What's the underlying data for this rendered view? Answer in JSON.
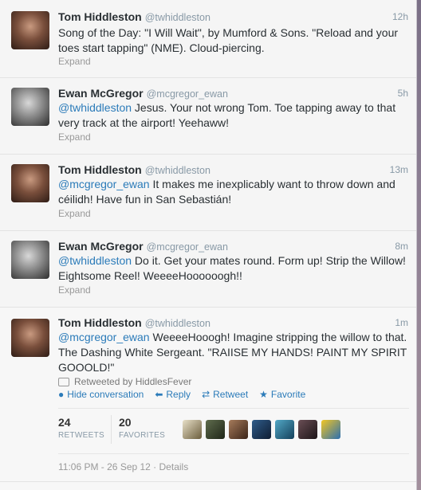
{
  "tweets": [
    {
      "name": "Tom Hiddleston",
      "handle": "@twhiddleston",
      "time": "12h",
      "mention": "",
      "text": "Song of the Day: \"I Will Wait\", by Mumford & Sons. \"Reload and your toes start tapping\" (NME). Cloud-piercing.",
      "expand": "Expand"
    },
    {
      "name": "Ewan McGregor",
      "handle": "@mcgregor_ewan",
      "time": "5h",
      "mention": "@twhiddleston",
      "text": " Jesus. Your not wrong Tom. Toe tapping away to that very track at the airport! Yeehaww!",
      "expand": "Expand"
    },
    {
      "name": "Tom Hiddleston",
      "handle": "@twhiddleston",
      "time": "13m",
      "mention": "@mcgregor_ewan",
      "text": " It makes me inexplicably want to throw down and céilidh! Have fun in San Sebastián!",
      "expand": "Expand"
    },
    {
      "name": "Ewan McGregor",
      "handle": "@mcgregor_ewan",
      "time": "8m",
      "mention": "@twhiddleston",
      "text": " Do it. Get your mates round. Form up! Strip the Willow! Eightsome Reel! WeeeeHoooooogh!!",
      "expand": "Expand"
    },
    {
      "name": "Tom Hiddleston",
      "handle": "@twhiddleston",
      "time": "1m",
      "mention": "@mcgregor_ewan",
      "text": " WeeeeHooogh! Imagine stripping the willow to that. The Dashing White Sergeant. \"RAIISE MY HANDS! PAINT MY SPIRIT GOOOLD!\""
    }
  ],
  "expanded": {
    "retweeted_by": "Retweeted by HiddlesFever",
    "actions": {
      "hide": "Hide conversation",
      "reply": "Reply",
      "retweet": "Retweet",
      "favorite": "Favorite"
    },
    "stats": {
      "retweets_count": "24",
      "retweets_label": "RETWEETS",
      "favorites_count": "20",
      "favorites_label": "FAVORITES"
    },
    "footer": "11:06 PM - 26 Sep 12 · Details"
  },
  "colors": {
    "link": "#2b7bb9",
    "text": "#292f33",
    "muted": "#8899a6"
  },
  "icons": {
    "hide": "speech-bubble-icon",
    "reply": "reply-arrow-icon",
    "retweet": "retweet-icon",
    "favorite": "star-icon"
  }
}
